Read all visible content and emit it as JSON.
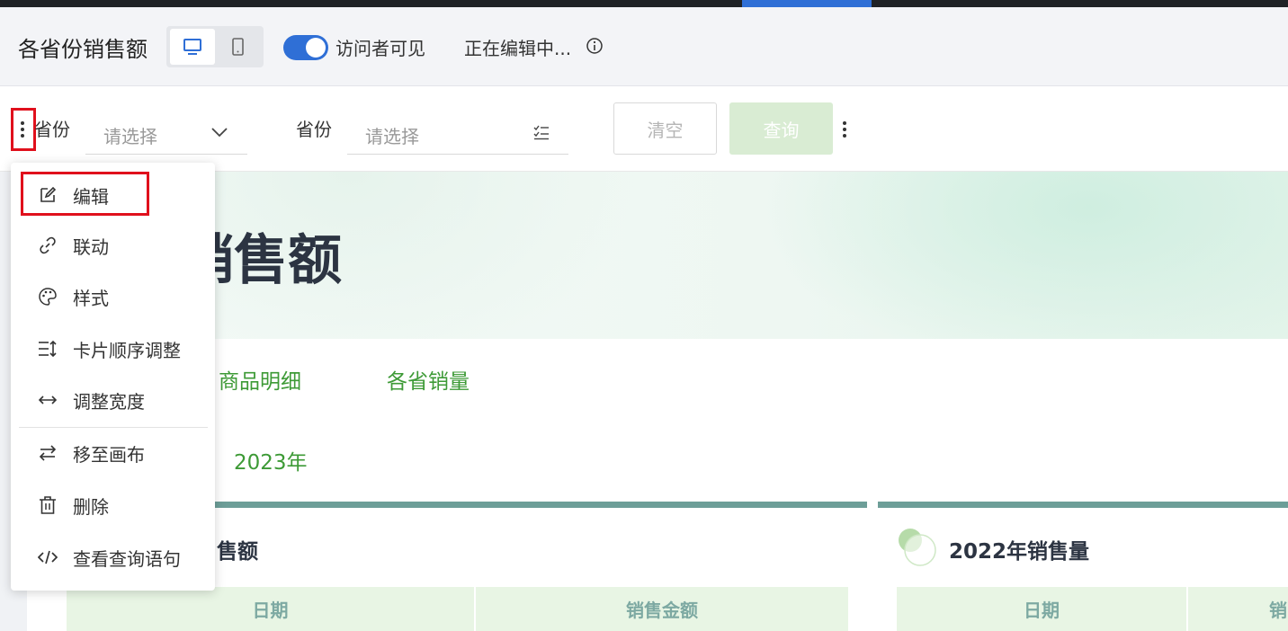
{
  "header": {
    "title": "各省份销售额",
    "visitor_visible_label": "访问者可见",
    "editing_status": "正在编辑中..."
  },
  "filters": [
    {
      "label": "省份",
      "placeholder": "请选择"
    },
    {
      "label": "省份",
      "placeholder": "请选择"
    }
  ],
  "buttons": {
    "clear": "清空",
    "query": "查询"
  },
  "context_menu": {
    "items": [
      {
        "label": "编辑",
        "icon": "edit-icon"
      },
      {
        "label": "联动",
        "icon": "link-icon"
      },
      {
        "label": "样式",
        "icon": "palette-icon"
      },
      {
        "label": "卡片顺序调整",
        "icon": "reorder-icon"
      },
      {
        "label": "调整宽度",
        "icon": "resize-width-icon"
      },
      {
        "label": "移至画布",
        "icon": "move-to-canvas-icon"
      },
      {
        "label": "删除",
        "icon": "trash-icon"
      },
      {
        "label": "查看查询语句",
        "icon": "code-icon"
      }
    ]
  },
  "banner": {
    "title": "份销售额"
  },
  "tabs": [
    {
      "label": "商品明细"
    },
    {
      "label": "各省销量"
    }
  ],
  "year_tab": "2023年",
  "cards": [
    {
      "title": "售额",
      "headers": [
        "日期",
        "销售金额"
      ]
    },
    {
      "title": "2022年销售量",
      "headers": [
        "日期",
        "销"
      ]
    }
  ],
  "colors": {
    "accent_blue": "#2f6fd6",
    "accent_green": "#3d9a36",
    "highlight_red": "#e0101c"
  }
}
